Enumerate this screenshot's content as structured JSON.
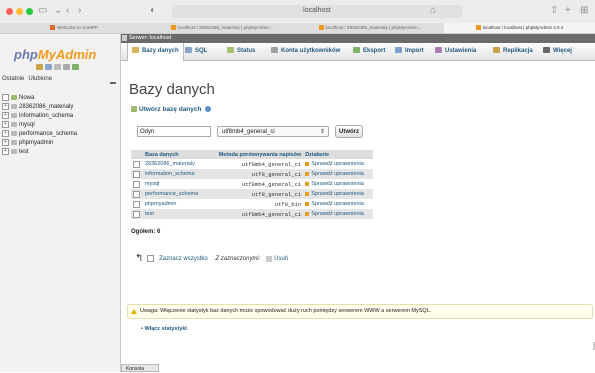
{
  "browser": {
    "url": "localhost",
    "tabs": [
      {
        "label": "Welcome to XAMPP",
        "active": false
      },
      {
        "label": "localhost / 28362086_materialy | phpMyAdmin...",
        "active": false
      },
      {
        "label": "localhost / 28362086_materialy | phpMyAdmin...",
        "active": false
      },
      {
        "label": "localhost / localhost | phpMyAdmin 4.0.4",
        "active": true
      }
    ]
  },
  "sidebar": {
    "logo_php": "php",
    "logo_myadmin": "MyAdmin",
    "nav_recent": "Ostatnie",
    "nav_favorites": "Ulubione",
    "tree": [
      {
        "label": "Nowa",
        "type": "new"
      },
      {
        "label": "28362086_materialy",
        "type": "db"
      },
      {
        "label": "information_schema",
        "type": "db"
      },
      {
        "label": "mysql",
        "type": "db"
      },
      {
        "label": "performance_schema",
        "type": "db"
      },
      {
        "label": "phpmyadmin",
        "type": "db"
      },
      {
        "label": "test",
        "type": "db"
      }
    ]
  },
  "main": {
    "server_label": "Serwer: localhost",
    "menu": [
      {
        "label": "Bazy danych",
        "active": true,
        "color": "#d8b85a"
      },
      {
        "label": "SQL",
        "active": false,
        "color": "#8aa3c7"
      },
      {
        "label": "Status",
        "active": false,
        "color": "#a7c06f"
      },
      {
        "label": "Konta użytkowników",
        "active": false,
        "color": "#a0a0a0"
      },
      {
        "label": "Eksport",
        "active": false,
        "color": "#7fae6a"
      },
      {
        "label": "Import",
        "active": false,
        "color": "#7aa1cc"
      },
      {
        "label": "Ustawienia",
        "active": false,
        "color": "#b07ab8"
      },
      {
        "label": "Replikacja",
        "active": false,
        "color": "#c9a44a"
      },
      {
        "label": "Więcej",
        "active": false,
        "color": "#666666"
      }
    ],
    "heading": "Bazy danych",
    "create_label": "Utwórz bazę danych",
    "create_input_value": "Odyn",
    "collation_value": "utf8mb4_general_ci",
    "create_button": "Utwórz",
    "table": {
      "headers": [
        "Baza danych",
        "Metoda porównywania napisów",
        "Działanie"
      ],
      "rows": [
        {
          "name": "28362086_materialy",
          "collation": "utf8mb4_general_ci",
          "action": "Sprawdź uprawnienia"
        },
        {
          "name": "information_schema",
          "collation": "utf8_general_ci",
          "action": "Sprawdź uprawnienia"
        },
        {
          "name": "mysql",
          "collation": "utf8mb4_general_ci",
          "action": "Sprawdź uprawnienia"
        },
        {
          "name": "performance_schema",
          "collation": "utf8_general_ci",
          "action": "Sprawdź uprawnienia"
        },
        {
          "name": "phpmyadmin",
          "collation": "utf8_bin",
          "action": "Sprawdź uprawnienia"
        },
        {
          "name": "test",
          "collation": "utf8mb4_general_ci",
          "action": "Sprawdź uprawnienia"
        }
      ],
      "total": "Ogółem: 6"
    },
    "check_all": "Zaznacz wszystko",
    "with_selected": "Z zaznaczonymi:",
    "delete": "Usuń",
    "notice": "Uwaga: Włączenie statystyk baz danych może spowodować duży ruch pomiędzy serwerem WWW a serwerem MySQL.",
    "enable_stats": "Włącz statystyki",
    "console": "Konsola"
  }
}
